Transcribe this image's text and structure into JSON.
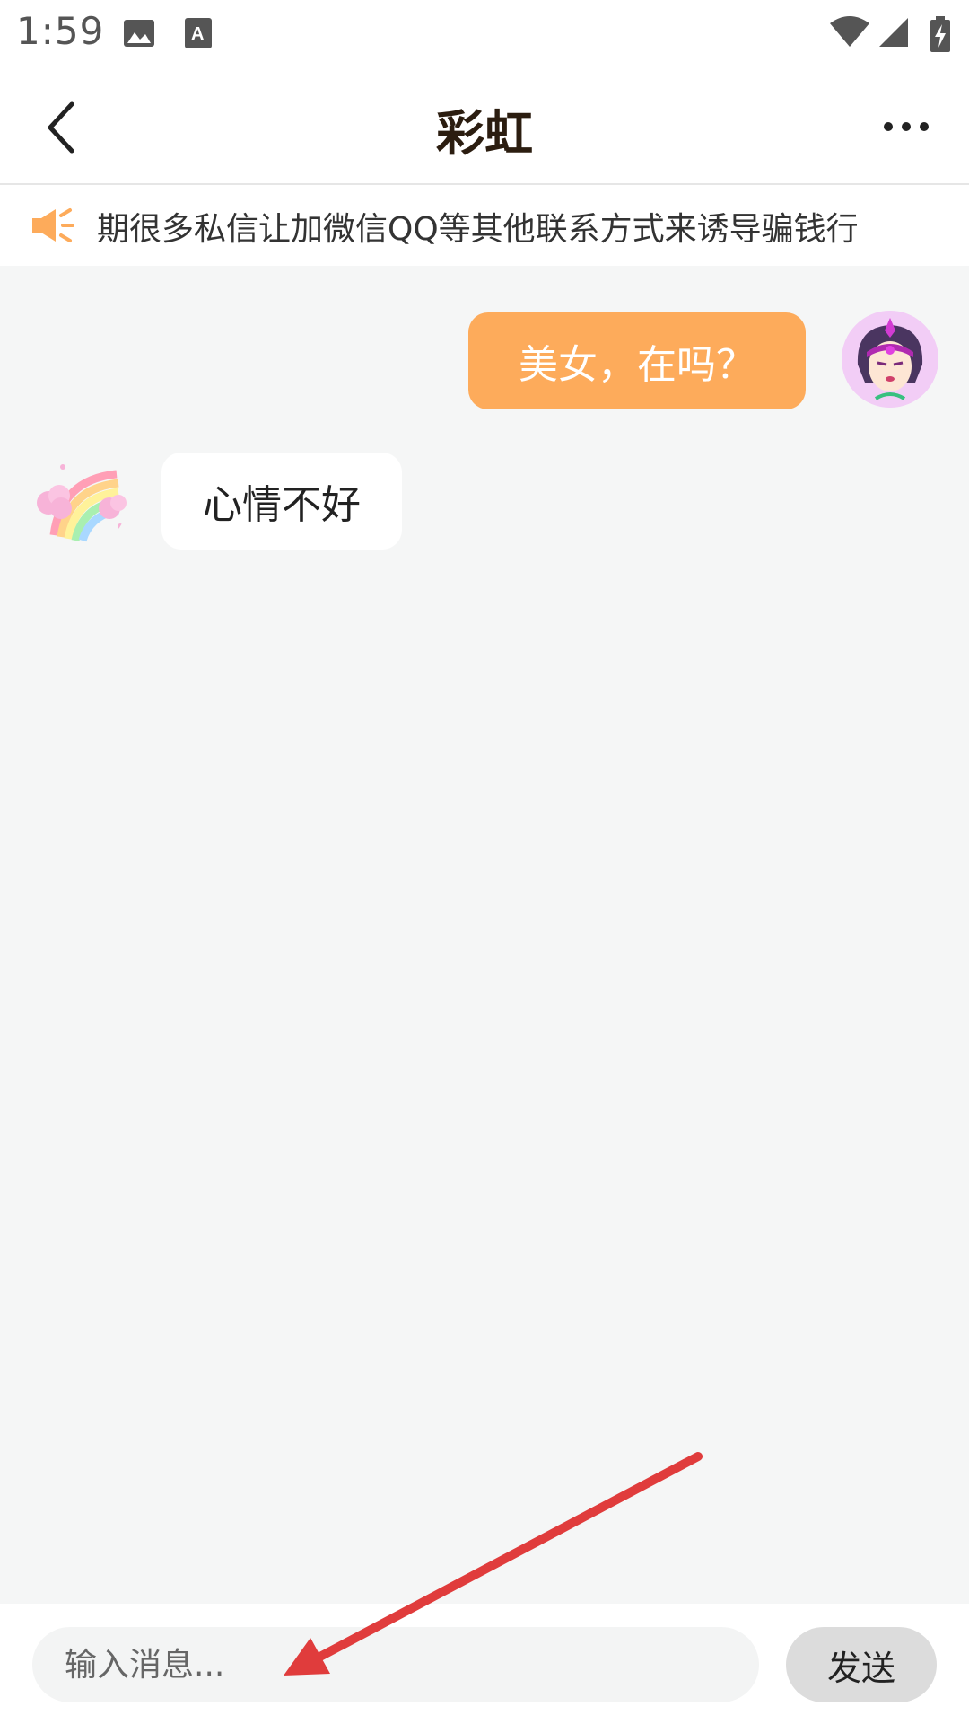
{
  "status_bar": {
    "time": "1:59",
    "icons": [
      "image-icon",
      "text-app-icon",
      "wifi-icon",
      "signal-icon",
      "battery-charging-icon"
    ]
  },
  "nav": {
    "title": "彩虹",
    "back_icon": "chevron-left-icon",
    "more_icon": "more-dots-icon"
  },
  "notice": {
    "icon": "megaphone-icon",
    "text": "期很多私信让加微信QQ等其他联系方式来诱导骗钱行"
  },
  "messages": [
    {
      "direction": "outgoing",
      "text": "美女，在吗？",
      "avatar": "purple-hair-girl-avatar"
    },
    {
      "direction": "incoming",
      "text": "心情不好",
      "avatar": "rainbow-avatar"
    }
  ],
  "input_bar": {
    "placeholder": "输入消息...",
    "value": "",
    "send_label": "发送"
  },
  "colors": {
    "accent": "#fdab5b",
    "background": "#f5f6f6",
    "annotation_arrow": "#e03c3c"
  }
}
